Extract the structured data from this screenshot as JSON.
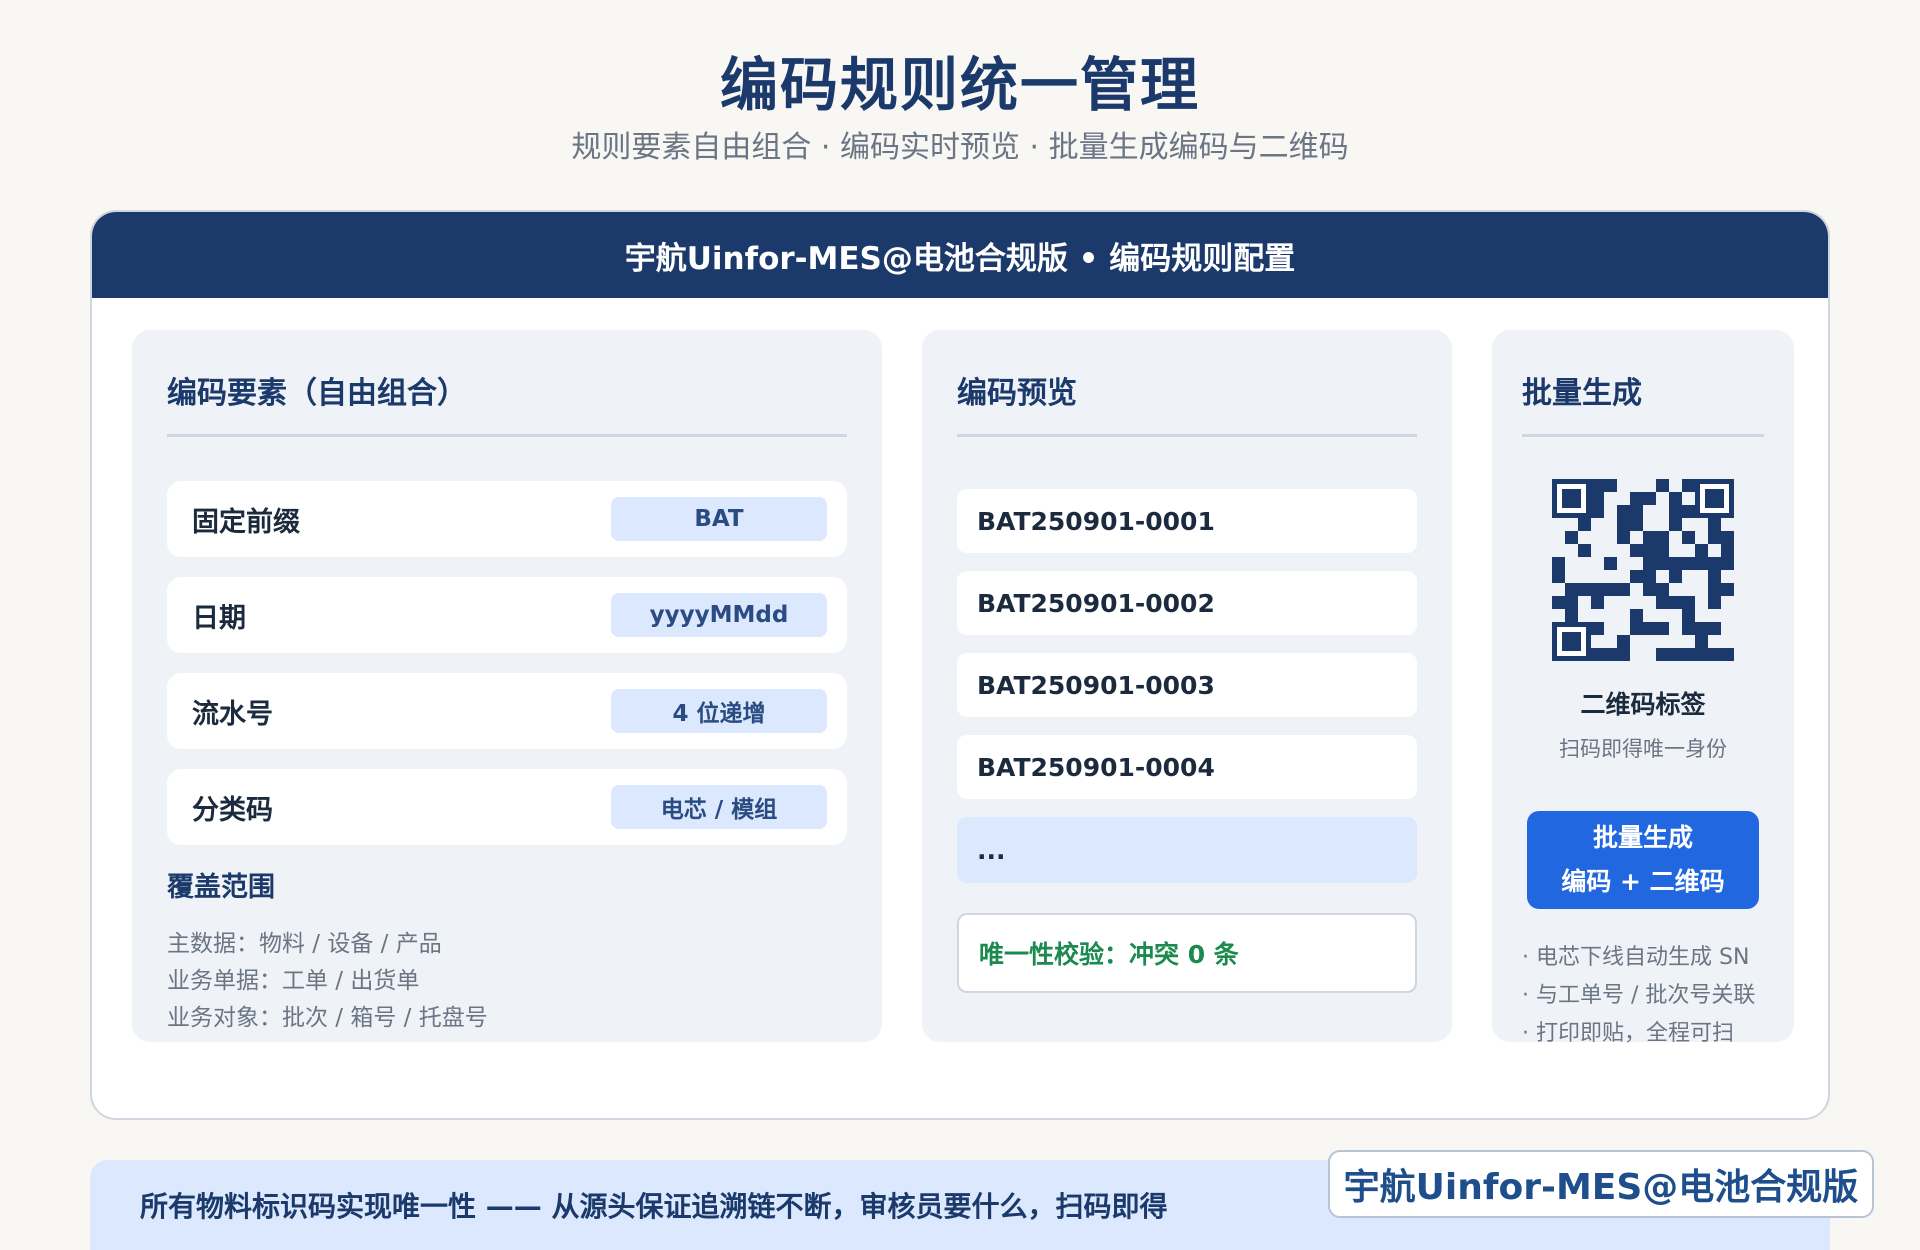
{
  "page": {
    "title": "编码规则统一管理",
    "subtitle": "规则要素自由组合 · 编码实时预览 · 批量生成编码与二维码"
  },
  "card": {
    "header": "宇航Uinfor-MES@电池合规版 • 编码规则配置"
  },
  "elements_panel": {
    "title": "编码要素（自由组合）",
    "items": [
      {
        "label": "固定前缀",
        "value": "BAT"
      },
      {
        "label": "日期",
        "value": "yyyyMMdd"
      },
      {
        "label": "流水号",
        "value": "4 位递增"
      },
      {
        "label": "分类码",
        "value": "电芯 / 模组"
      }
    ],
    "coverage_title": "覆盖范围",
    "coverage": [
      "主数据：物料 / 设备 / 产品",
      "业务单据：工单 / 出货单",
      "业务对象：批次 / 箱号 / 托盘号"
    ]
  },
  "preview_panel": {
    "title": "编码预览",
    "codes": [
      "BAT250901-0001",
      "BAT250901-0002",
      "BAT250901-0003",
      "BAT250901-0004"
    ],
    "more": "...",
    "check": "唯一性校验：冲突 0 条"
  },
  "batch_panel": {
    "title": "批量生成",
    "qr_label": "二维码标签",
    "qr_sub": "扫码即得唯一身份",
    "button_line1": "批量生成",
    "button_line2": "编码 + 二维码",
    "features": [
      "· 电芯下线自动生成 SN",
      "· 与工单号 / 批次号关联",
      "· 打印即贴，全程可扫"
    ]
  },
  "footer": {
    "text": "所有物料标识码实现唯一性 —— 从源头保证追溯链不断，审核员要什么，扫码即得",
    "watermark": "宇航Uinfor-MES@电池合规版"
  },
  "colors": {
    "navy": "#1b3a6b",
    "accent_blue": "#2167e0",
    "chip_bg": "#dbe8fd",
    "success_green": "#1b8a4f",
    "panel_bg": "#eff3f8"
  }
}
